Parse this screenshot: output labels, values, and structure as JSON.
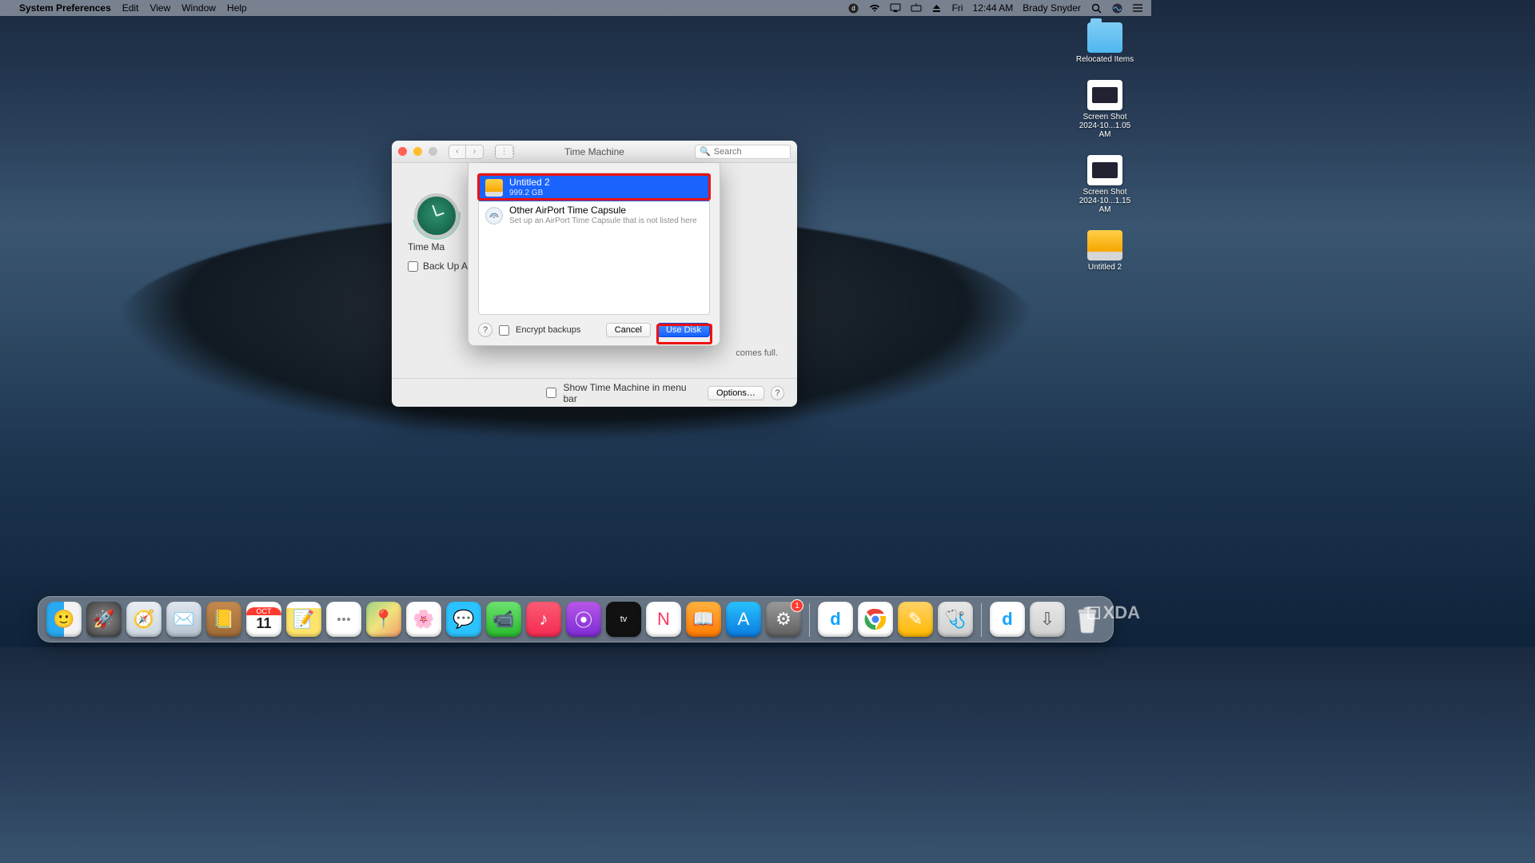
{
  "menubar": {
    "app_name": "System Preferences",
    "items": [
      "Edit",
      "View",
      "Window",
      "Help"
    ],
    "status": {
      "day": "Fri",
      "time": "12:44 AM",
      "user": "Brady Snyder"
    }
  },
  "desktop": {
    "icons": [
      {
        "kind": "folder",
        "label": "Relocated Items"
      },
      {
        "kind": "thumb",
        "label": "Screen Shot 2024-10...1.05 AM"
      },
      {
        "kind": "thumb",
        "label": "Screen Shot 2024-10...1.15 AM"
      },
      {
        "kind": "drive",
        "label": "Untitled 2"
      }
    ]
  },
  "window": {
    "title": "Time Machine",
    "search_placeholder": "Search",
    "tm_label": "Time Ma",
    "backup_auto_label": "Back Up Au",
    "hint_tail": "comes full.",
    "show_in_menubar": "Show Time Machine in menu bar",
    "options": "Options…"
  },
  "sheet": {
    "rows": [
      {
        "selected": true,
        "icon": "ext",
        "title": "Untitled 2",
        "sub": "999.2 GB"
      },
      {
        "selected": false,
        "icon": "tc",
        "title": "Other AirPort Time Capsule",
        "sub": "Set up an AirPort Time Capsule that is not listed here"
      }
    ],
    "encrypt": "Encrypt backups",
    "cancel": "Cancel",
    "use_disk": "Use Disk"
  },
  "dock": {
    "apps": [
      {
        "name": "finder",
        "glyph": "🙂"
      },
      {
        "name": "launchpad",
        "glyph": "🚀"
      },
      {
        "name": "safari",
        "glyph": "🧭"
      },
      {
        "name": "mail",
        "glyph": "✉️"
      },
      {
        "name": "contacts",
        "glyph": "📒"
      },
      {
        "name": "calendar",
        "month": "OCT",
        "day": "11"
      },
      {
        "name": "notes",
        "glyph": "📝"
      },
      {
        "name": "reminders",
        "glyph": ""
      },
      {
        "name": "maps",
        "glyph": "📍"
      },
      {
        "name": "photos",
        "glyph": "🌸"
      },
      {
        "name": "messages",
        "glyph": "💬"
      },
      {
        "name": "facetime",
        "glyph": "📹"
      },
      {
        "name": "music",
        "glyph": "♪"
      },
      {
        "name": "podcasts",
        "glyph": "⦿"
      },
      {
        "name": "tv",
        "glyph": "tv"
      },
      {
        "name": "news",
        "glyph": "N"
      },
      {
        "name": "books",
        "glyph": "📖"
      },
      {
        "name": "app-store",
        "glyph": "A"
      },
      {
        "name": "system-preferences",
        "glyph": "⚙︎",
        "badge": "1"
      }
    ],
    "right": [
      {
        "name": "dashlane",
        "glyph": "d"
      },
      {
        "name": "chrome",
        "glyph": "◉"
      },
      {
        "name": "pages",
        "glyph": "✎"
      },
      {
        "name": "utility",
        "glyph": "🩺"
      }
    ],
    "right2": [
      {
        "name": "dashlane-2",
        "glyph": "d"
      },
      {
        "name": "downloads",
        "glyph": "⇩"
      }
    ]
  },
  "watermark": "XDA"
}
